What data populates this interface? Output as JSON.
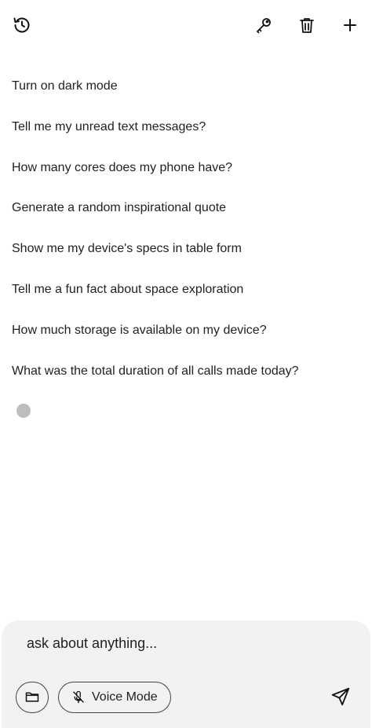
{
  "toolbar": {
    "history_icon": "history-icon",
    "key_icon": "key-icon",
    "trash_icon": "trash-icon",
    "new_icon": "plus-icon"
  },
  "suggestions": [
    "Turn on dark mode",
    "Tell me my unread text messages?",
    "How many cores does my phone have?",
    "Generate a random inspirational quote",
    "Show me my device's specs in table form",
    "Tell me a fun fact about space exploration",
    "How much storage is available on my device?",
    "What was the total duration of all calls made today?"
  ],
  "composer": {
    "placeholder": "ask about anything...",
    "voice_mode_label": "Voice Mode",
    "attach_icon": "folder-icon",
    "mic_icon": "mic-off-icon",
    "send_icon": "send-icon"
  },
  "colors": {
    "background": "#ffffff",
    "composer_bg": "#f2f2f2",
    "loading_dot": "#bdbdbd",
    "text": "#222222"
  }
}
